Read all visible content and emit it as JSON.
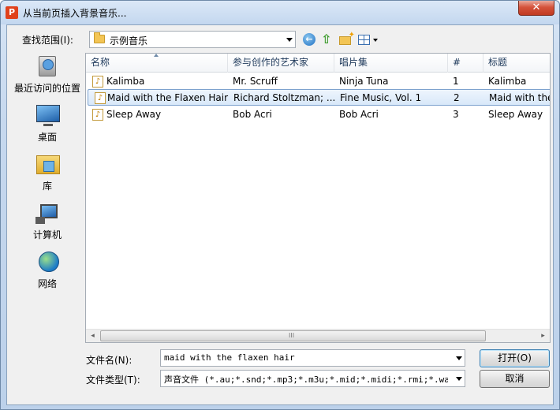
{
  "window": {
    "title": "从当前页插入背景音乐...",
    "app_icon_letter": "P",
    "close_glyph": "✕"
  },
  "lookin": {
    "label": "查找范围(I):",
    "value": "示例音乐"
  },
  "toolbar": {
    "back_icon": "back-arrow-icon",
    "up_icon": "up-folder-icon",
    "new_folder_icon": "new-folder-icon",
    "views_icon": "views-menu-icon"
  },
  "places": [
    {
      "label": "最近访问的位置",
      "icon": "recent-places-icon"
    },
    {
      "label": "桌面",
      "icon": "desktop-icon"
    },
    {
      "label": "库",
      "icon": "libraries-icon"
    },
    {
      "label": "计算机",
      "icon": "computer-icon"
    },
    {
      "label": "网络",
      "icon": "network-icon"
    }
  ],
  "filelist": {
    "columns": [
      "名称",
      "参与创作的艺术家",
      "唱片集",
      "#",
      "标题"
    ],
    "rows": [
      {
        "name": "Kalimba",
        "artist": "Mr. Scruff",
        "album": "Ninja Tuna",
        "num": "1",
        "title": "Kalimba",
        "selected": false
      },
      {
        "name": "Maid with the Flaxen Hair",
        "artist": "Richard Stoltzman; ...",
        "album": "Fine Music, Vol. 1",
        "num": "2",
        "title": "Maid with the",
        "selected": true
      },
      {
        "name": "Sleep Away",
        "artist": "Bob Acri",
        "album": "Bob Acri",
        "num": "3",
        "title": "Sleep Away",
        "selected": false
      }
    ],
    "scroll_left_glyph": "◂",
    "scroll_right_glyph": "▸",
    "scroll_grip": "III"
  },
  "filename": {
    "label": "文件名(N):",
    "value": "maid with the flaxen hair"
  },
  "filetype": {
    "label": "文件类型(T):",
    "value": "声音文件 (*.au;*.snd;*.mp3;*.m3u;*.mid;*.midi;*.rmi;*.wav;*."
  },
  "buttons": {
    "open": "打开(O)",
    "cancel": "取消"
  }
}
